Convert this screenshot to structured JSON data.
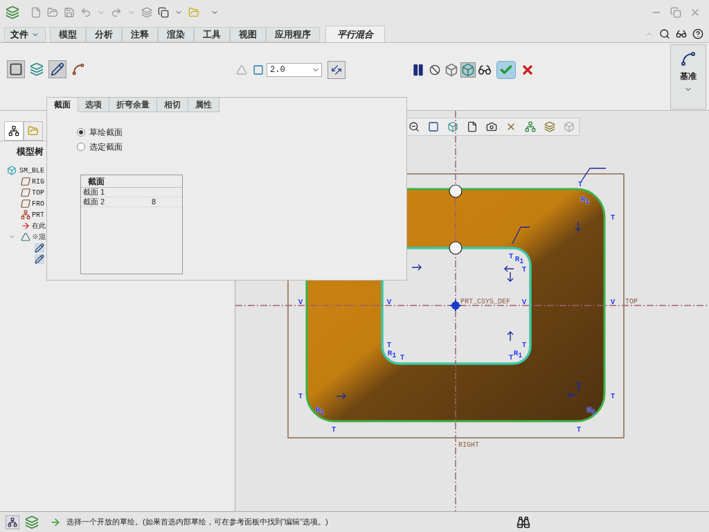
{
  "ribbon_tabs": [
    {
      "label": "文件",
      "kind": "menu",
      "selected": false
    },
    {
      "label": "模型",
      "kind": "tab",
      "selected": false
    },
    {
      "label": "分析",
      "kind": "tab",
      "selected": false
    },
    {
      "label": "注释",
      "kind": "tab",
      "selected": false
    },
    {
      "label": "渲染",
      "kind": "tab",
      "selected": false
    },
    {
      "label": "工具",
      "kind": "tab",
      "selected": false
    },
    {
      "label": "视图",
      "kind": "tab",
      "selected": false
    },
    {
      "label": "应用程序",
      "kind": "tab",
      "selected": false
    },
    {
      "label": "平行混合",
      "kind": "tab",
      "selected": true
    }
  ],
  "type_toggles": [
    {
      "kind": "solid",
      "selected": true
    },
    {
      "kind": "surface",
      "selected": false
    },
    {
      "kind": "sketch",
      "selected": true
    },
    {
      "kind": "curve",
      "selected": false
    }
  ],
  "thickness": {
    "value": "2.0"
  },
  "controls": [
    {
      "kind": "pause",
      "selected": false
    },
    {
      "kind": "no-preview",
      "selected": false
    },
    {
      "kind": "mesh-preview",
      "selected": false
    },
    {
      "kind": "verify-preview",
      "selected": true
    },
    {
      "kind": "glasses",
      "selected": false
    }
  ],
  "datum_group": {
    "label": "基准"
  },
  "model_tree": {
    "title": "模型树",
    "items": [
      {
        "label": "SM_BLE",
        "kind": "part",
        "children": [
          {
            "label": "RIG",
            "kind": "plane"
          },
          {
            "label": "TOP",
            "kind": "plane"
          },
          {
            "label": "FRO",
            "kind": "plane"
          },
          {
            "label": "PRT",
            "kind": "csys"
          },
          {
            "label": "在此",
            "kind": "insert"
          },
          {
            "label": "※混",
            "kind": "blend",
            "expanded": true,
            "children": [
              {
                "kind": "sketch"
              },
              {
                "kind": "sketch"
              }
            ]
          }
        ]
      }
    ]
  },
  "dashboard": {
    "tabs": [
      {
        "label": "截面",
        "selected": true
      },
      {
        "label": "选项",
        "selected": false
      },
      {
        "label": "折弯余量",
        "selected": false
      },
      {
        "label": "相切",
        "selected": false
      },
      {
        "label": "属性",
        "selected": false
      }
    ],
    "radios": [
      {
        "label": "草绘截面",
        "selected": true
      },
      {
        "label": "选定截面",
        "selected": false
      }
    ],
    "table": {
      "header": "截面",
      "rows": [
        {
          "name": "截面 1"
        },
        {
          "name": "截面 2",
          "value": "8"
        }
      ]
    }
  },
  "canvas": {
    "csys_label": "PRT_CSYS_DEF",
    "top_label": "TOP",
    "right_label": "RIGHT",
    "marks": [
      "T",
      "R$_{1}$",
      "T",
      "T",
      "R$_{1}$",
      "T",
      "V",
      "V",
      "V",
      "V",
      "T",
      "R$_{1}$",
      "T",
      "T",
      "R$_{1}$",
      "T",
      "T",
      "R$_{1}$",
      "T",
      "T",
      "R$_{1}$",
      "T"
    ]
  },
  "status_bar": {
    "message": "选择一个开放的草绘。(如果首选内部草绘，可在参考面板中找到“编辑”选项。)"
  }
}
